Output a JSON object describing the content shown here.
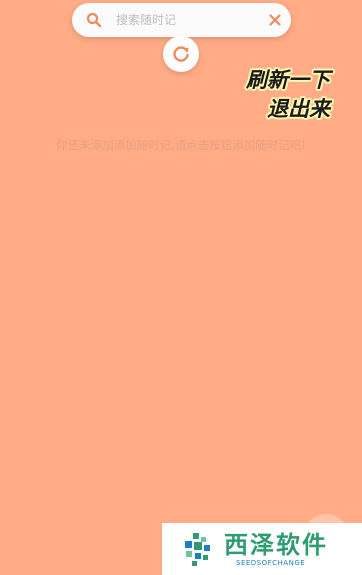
{
  "search": {
    "placeholder": "搜索随时记",
    "value": ""
  },
  "overlay": {
    "line1": "刷新一下",
    "line2": "退出来"
  },
  "empty_state": {
    "message": "你还未添加添加随时记,请点击按钮添加随时记吧!"
  },
  "watermark": {
    "title": "西泽软件",
    "subtitle": "SEEDSOFCHANGE"
  },
  "colors": {
    "background": "#FFAB85",
    "accent": "#F08A5D",
    "logo_green": "#2E9C70",
    "logo_blue": "#1E7FC2"
  },
  "icons": {
    "search": "search-icon",
    "close": "close-icon",
    "refresh": "refresh-icon"
  }
}
